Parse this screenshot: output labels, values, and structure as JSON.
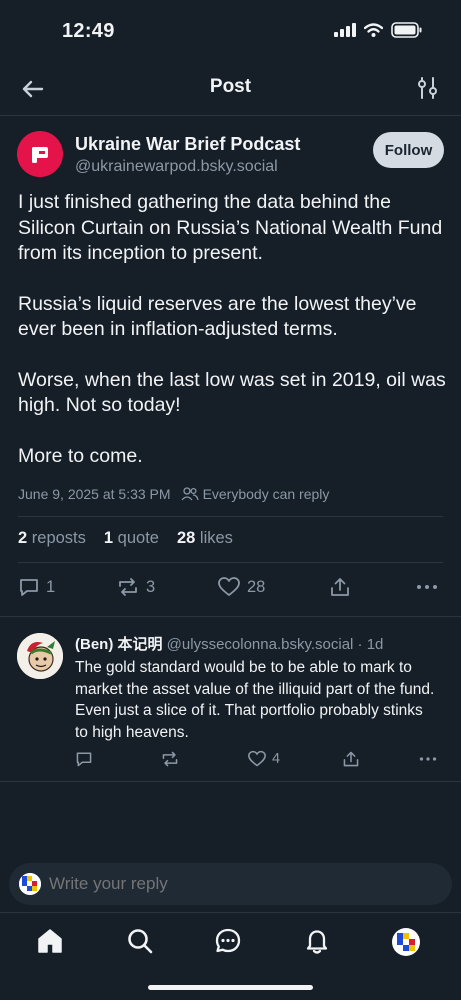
{
  "status_bar": {
    "time": "12:49"
  },
  "header": {
    "title": "Post"
  },
  "post": {
    "author_name": "Ukraine War Brief Podcast",
    "author_handle": "@ukrainewarpod.bsky.social",
    "follow_label": "Follow",
    "paragraphs": [
      "I just finished gathering the data behind the Silicon Curtain on Russia’s National Wealth Fund from its inception to present.",
      "Russia’s liquid reserves are the lowest they’ve ever been in inflation-adjusted terms.",
      "Worse, when the last low was set in 2019, oil was high. Not so today!",
      "More to come."
    ],
    "timestamp": "June 9, 2025 at 5:33 PM",
    "audience": "Everybody can reply",
    "stats": {
      "reposts_count": "2",
      "reposts_label": "reposts",
      "quotes_count": "1",
      "quotes_label": "quote",
      "likes_count": "28",
      "likes_label": "likes"
    },
    "actions": {
      "replies": "1",
      "reposts": "3",
      "likes": "28"
    }
  },
  "reply": {
    "author_name": "(Ben) 本记明",
    "author_handle": "@ulyssecolonna.bsky.social",
    "age": "· 1d",
    "text": "The gold standard would be to be able to mark to market the asset value of the illiquid part of the fund. Even just a slice of it. That portfolio probably stinks to high heavens.",
    "likes": "4"
  },
  "composer": {
    "placeholder": "Write your reply"
  },
  "colors": {
    "background": "#161e27",
    "divider": "#2b3540",
    "muted_text": "#8b98a6",
    "brand_avatar": "#e4144a",
    "follow_button": "#d4dbe2"
  },
  "icons": {
    "header": [
      "back-arrow-icon",
      "filter-sliders-icon"
    ],
    "actions": [
      "reply-icon",
      "repost-icon",
      "heart-icon",
      "share-icon",
      "more-icon"
    ],
    "tabs": [
      "home-icon",
      "search-icon",
      "chat-icon",
      "bell-icon",
      "profile-avatar"
    ]
  }
}
